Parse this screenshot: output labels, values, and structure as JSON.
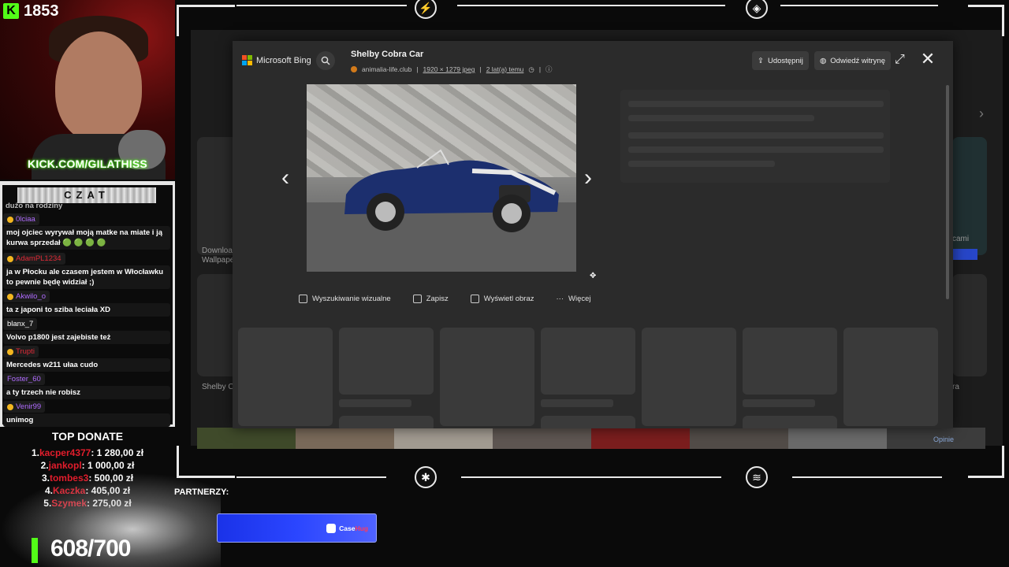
{
  "stream": {
    "viewer_count": "1853",
    "kick_url": "KICK.COM/GILATHISS",
    "chat_title": "CZAT",
    "chat_partial_top": "dużo na rodziny",
    "chat": [
      {
        "user": "0lciaa",
        "color": "#b06bff",
        "badge": true,
        "text": "moj ojciec wyrywał moją matke na miate i ją kurwa sprzedał 🟢 🟢 🟢 🟢"
      },
      {
        "user": "AdamPL1234",
        "color": "#e02a37",
        "badge": true,
        "text": "ja w Płocku ale czasem jestem w Włocławku to pewnie będę widział ;)"
      },
      {
        "user": "Akwilo_o",
        "color": "#b06bff",
        "badge": true,
        "text": "ta z japoni to sziba leciała XD"
      },
      {
        "user": "blanx_7",
        "color": "#ffffff",
        "badge": false,
        "text": "Volvo p1800 jest zajebiste też"
      },
      {
        "user": "Trupti",
        "color": "#e02a37",
        "badge": true,
        "text": "Mercedes w211 ułaa cudo"
      },
      {
        "user": "Foster_60",
        "color": "#b06bff",
        "badge": false,
        "text": "a ty trzech nie robisz"
      },
      {
        "user": "Venir99",
        "color": "#b06bff",
        "badge": true,
        "text": "unimog"
      }
    ],
    "top_donate_title": "TOP DONATE",
    "donations": [
      {
        "rank": "1.",
        "name": "kacper4377",
        "amount": ": 1 280,00 zł"
      },
      {
        "rank": "2.",
        "name": "jankopl",
        "amount": ": 1 000,00 zł"
      },
      {
        "rank": "3.",
        "name": "tombes3",
        "amount": ": 500,00 zł"
      },
      {
        "rank": "4.",
        "name": "Kaczka",
        "amount": ": 405,00 zł"
      },
      {
        "rank": "5.",
        "name": "Szymek",
        "amount": ": 275,00 zł"
      }
    ],
    "goal_text": "608/700",
    "partners_label": "PARTNERZY:",
    "sponsor_name": "Case",
    "sponsor_name_accent": "Hug"
  },
  "bing": {
    "brand": "Microsoft Bing",
    "image_title": "Shelby Cobra Car",
    "source": "animalia-life.club",
    "dimensions": "1920 × 1279 jpeg",
    "age": "2 lat(a) temu",
    "share_label": "Udostępnij",
    "visit_label": "Odwiedź witrynę",
    "actions": {
      "visual_search": "Wyszukiwanie wizualne",
      "save": "Zapisz",
      "view_image": "Wyświetl obraz",
      "more": "Więcej"
    },
    "bg_texts": {
      "download": "Download",
      "wallpaper": "Wallpaper",
      "shelby": "Shelby Co",
      "right_a": "cami",
      "right_b": "ra",
      "opinie": "Opinie"
    }
  },
  "colors": {
    "kick_green": "#53fc18",
    "donor_red": "#e21d2c",
    "sponsor_blue": "#2b46ff"
  }
}
